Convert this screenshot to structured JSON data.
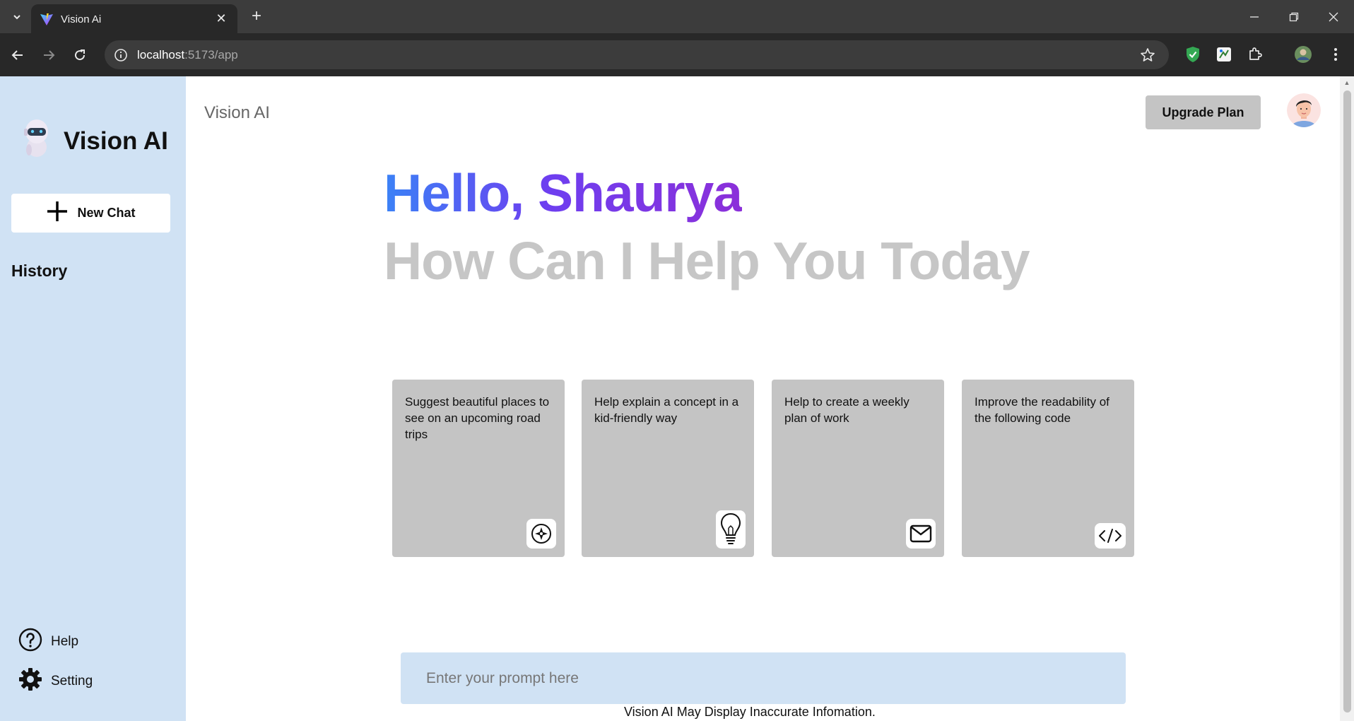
{
  "browser": {
    "tab_title": "Vision Ai",
    "url_host": "localhost",
    "url_rest": ":5173/app",
    "tab_close_glyph": "✕",
    "new_tab_glyph": "+",
    "icons": [
      "tab-search-icon",
      "vite-favicon-icon",
      "close-icon",
      "plus-icon",
      "minimize-icon",
      "restore-icon",
      "window-close-icon",
      "back-icon",
      "forward-icon",
      "reload-icon",
      "site-info-icon",
      "star-icon",
      "shield-extension-icon",
      "extension-icon",
      "puzzle-icon",
      "profile-icon",
      "more-icon"
    ]
  },
  "sidebar": {
    "logo_text": "Vision AI",
    "new_chat_label": "New Chat",
    "history_label": "History",
    "help_label": "Help",
    "setting_label": "Setting"
  },
  "header": {
    "brand": "Vision AI",
    "upgrade_label": "Upgrade Plan"
  },
  "greeting": {
    "hello": "Hello, Shaurya",
    "subtitle": "How Can I Help You Today"
  },
  "cards": [
    {
      "text": "Suggest beautiful places to see on an upcoming road trips",
      "icon": "compass-icon"
    },
    {
      "text": "Help explain a concept in a kid-friendly way",
      "icon": "bulb-icon"
    },
    {
      "text": "Help to create a weekly plan of work",
      "icon": "mail-icon"
    },
    {
      "text": "Improve the readability of the following code",
      "icon": "code-icon"
    }
  ],
  "prompt": {
    "placeholder": "Enter your prompt here"
  },
  "footer": {
    "disclaimer": "Vision AI May Display Inaccurate Infomation."
  },
  "colors": {
    "sidebar_bg": "#d0e2f4",
    "card_bg": "#c4c4c4",
    "gradient_start": "#3b82f6",
    "gradient_end": "#8b2fd9",
    "subtitle": "#c6c6c6"
  }
}
